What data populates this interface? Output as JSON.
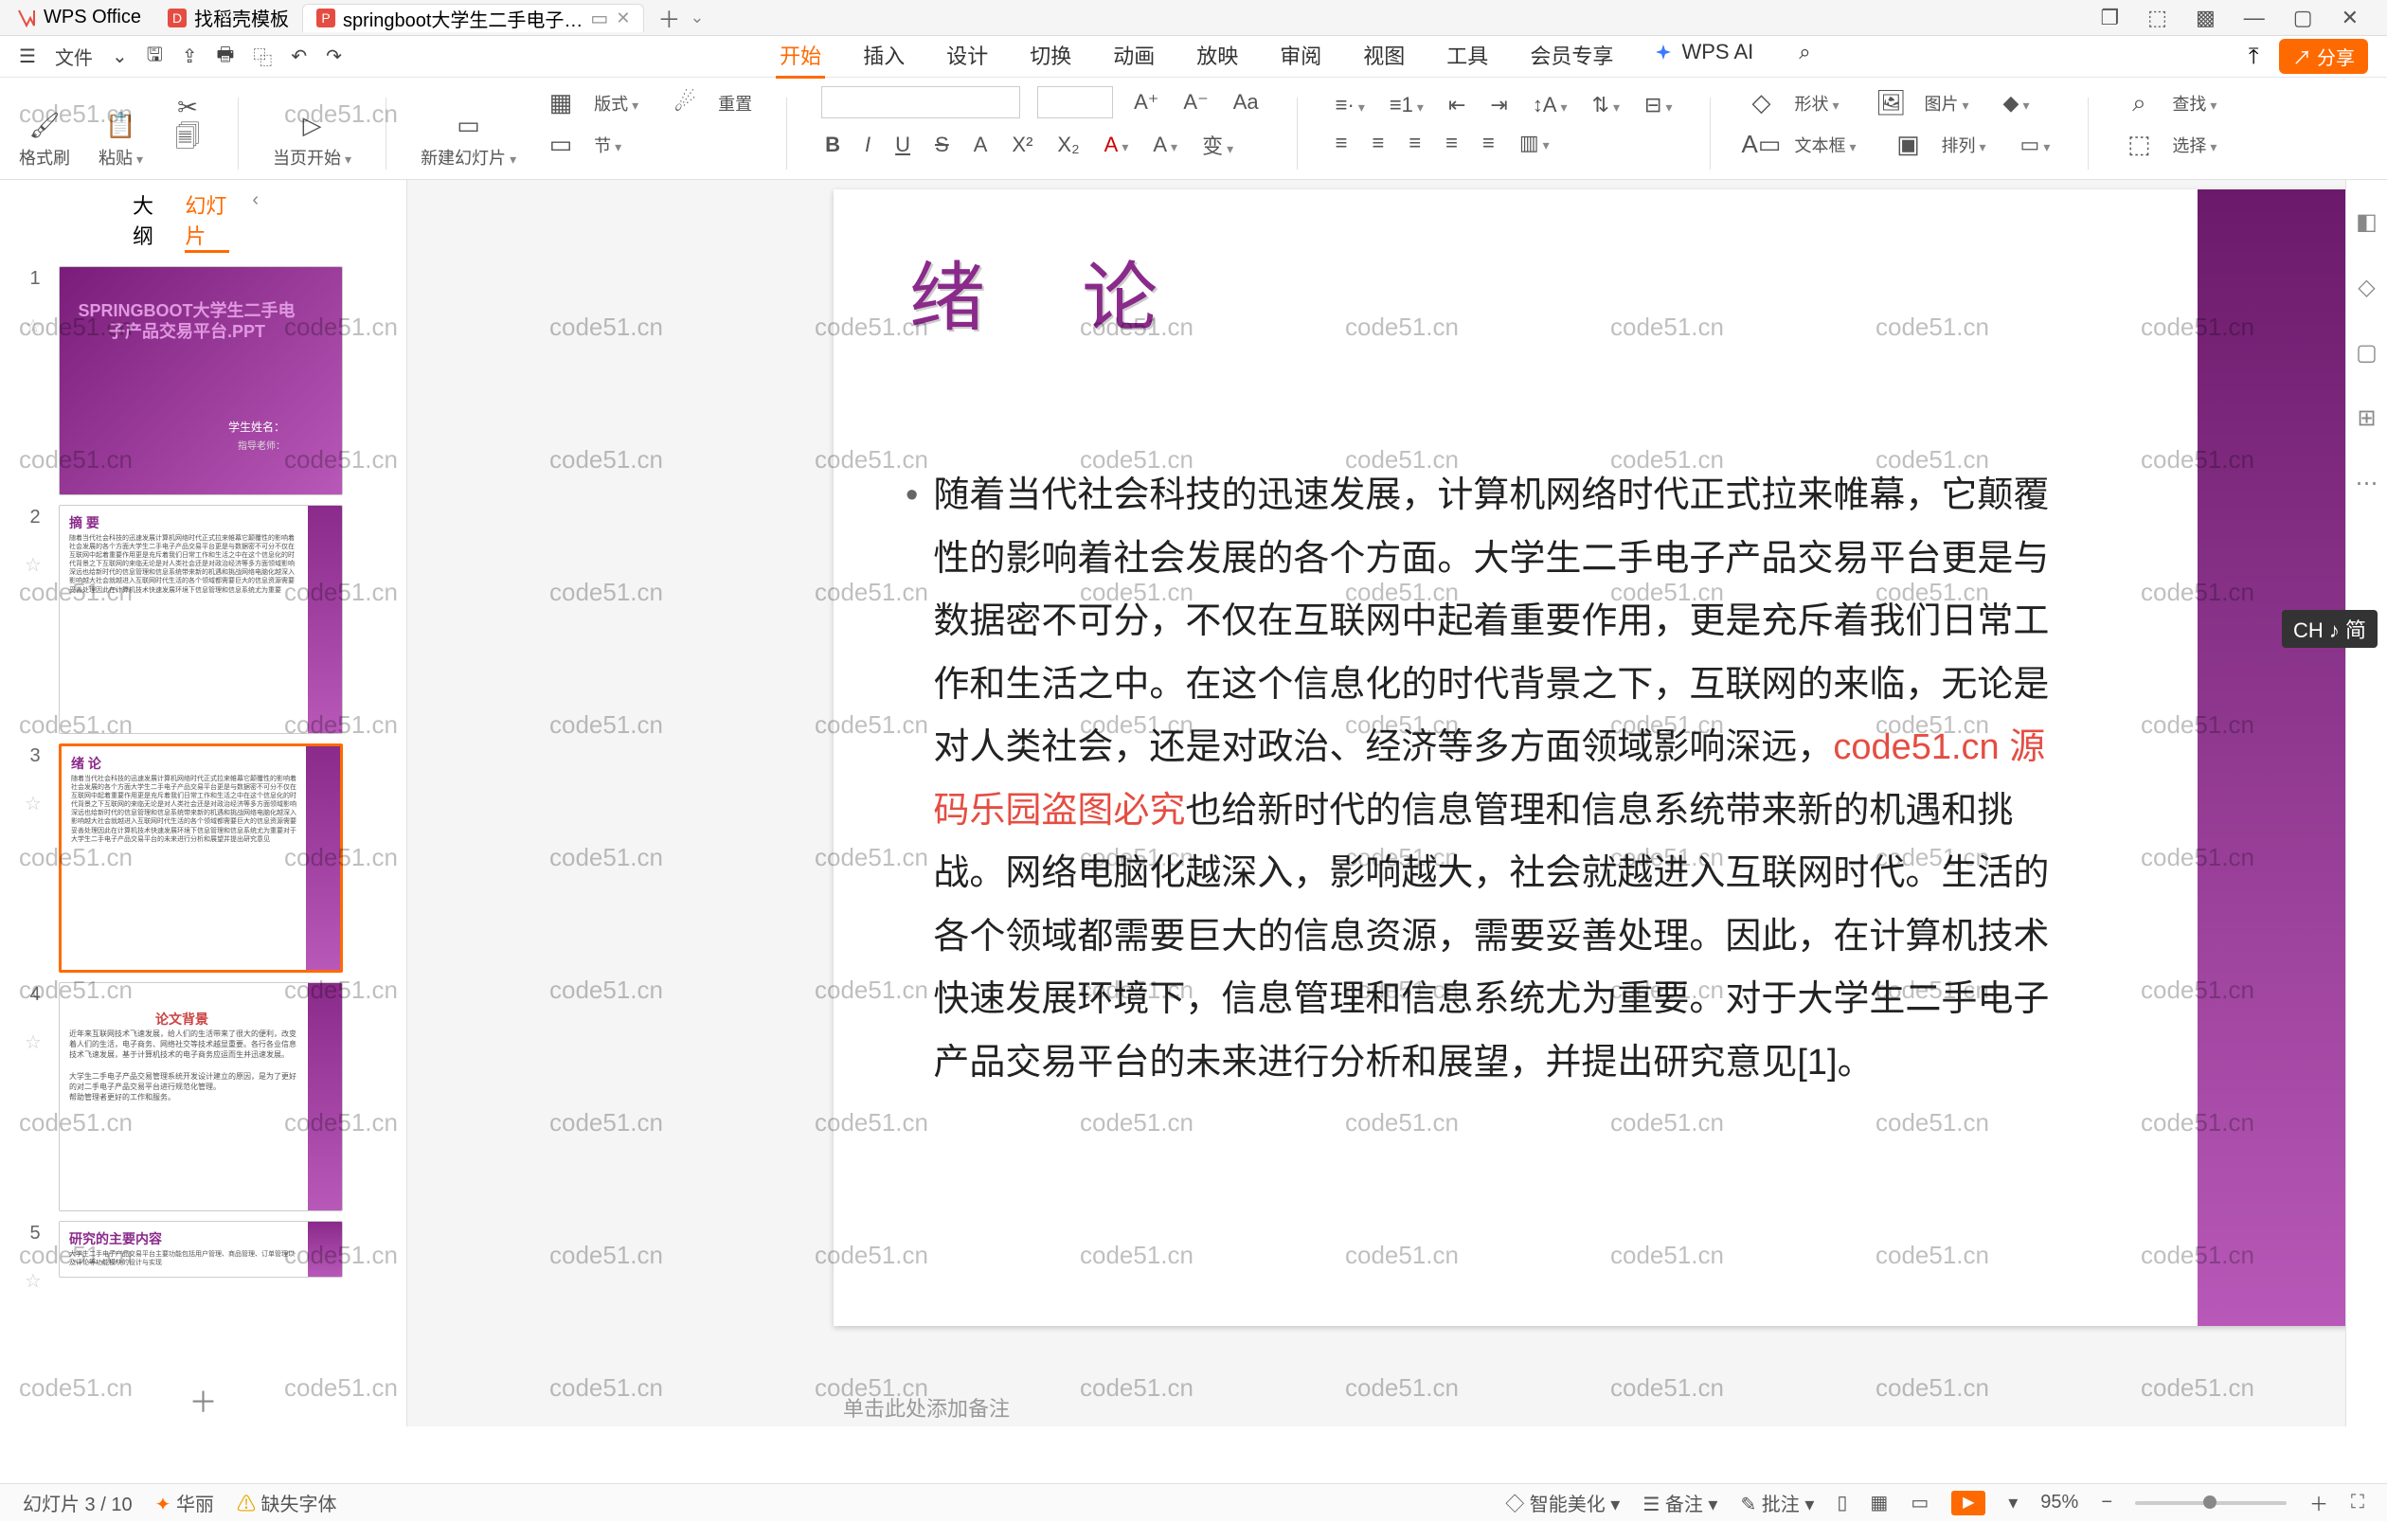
{
  "tabs": {
    "home_label": "WPS Office",
    "docer_label": "找稻壳模板",
    "active_label": "springboot大学生二手电子…",
    "active_icon": "P",
    "docer_icon": "D"
  },
  "qa": {
    "file_menu": "文件"
  },
  "menu": {
    "start": "开始",
    "insert": "插入",
    "design": "设计",
    "transition": "切换",
    "animation": "动画",
    "slideshow": "放映",
    "review": "审阅",
    "view": "视图",
    "tools": "工具",
    "member": "会员专享",
    "wpsai": "WPS AI"
  },
  "share_label": "分享",
  "ribbon": {
    "format_painter": "格式刷",
    "paste": "粘贴",
    "from_current": "当页开始",
    "new_slide": "新建幻灯片",
    "layout": "版式",
    "section": "节",
    "reset": "重置",
    "shape": "形状",
    "picture": "图片",
    "textbox": "文本框",
    "arrange": "排列",
    "find": "查找",
    "select": "选择"
  },
  "side": {
    "outline": "大纲",
    "slides": "幻灯片",
    "t1": "1",
    "t2": "2",
    "t3": "3",
    "t4": "4",
    "t5": "5"
  },
  "thumb1": {
    "title": "SPRINGBOOT大学生二手电子产品交易平台.PPT",
    "sub": "学生姓名：",
    "sub2": "指导老师："
  },
  "thumb2": {
    "title": "摘 要"
  },
  "thumb3": {
    "title": "绪 论"
  },
  "thumb4": {
    "title": "论文背景"
  },
  "thumb5": {
    "title": "研究的主要内容"
  },
  "slide": {
    "title": "绪  论",
    "body": "随着当代社会科技的迅速发展，计算机网络时代正式拉来帷幕，它颠覆性的影响着社会发展的各个方面。大学生二手电子产品交易平台更是与数据密不可分，不仅在互联网中起着重要作用，更是充斥着我们日常工作和生活之中。在这个信息化的时代背景之下，互联网的来临，无论是对人类社会，还是对政治、经济等多方面领域影响深远，",
    "wm": "code51.cn",
    "wm_red": "源码乐园盗图必究",
    "body2": "也给新时代的信息管理和信息系统带来新的机遇和挑战。网络电脑化越深入，影响越大，社会就越进入互联网时代。生活的各个领域都需要巨大的信息资源，需要妥善处理。因此，在计算机技术快速发展环境下，信息管理和信息系统尤为重要。对于大学生二手电子产品交易平台的未来进行分析和展望，并提出研究意见[1]。"
  },
  "notes_placeholder": "单击此处添加备注",
  "status": {
    "slide_counter": "幻灯片 3 / 10",
    "theme": "华丽",
    "missing": "缺失字体",
    "beautify": "智能美化",
    "notes": "备注",
    "comment": "批注",
    "zoom": "95%"
  },
  "ime": "CH ♪ 简"
}
